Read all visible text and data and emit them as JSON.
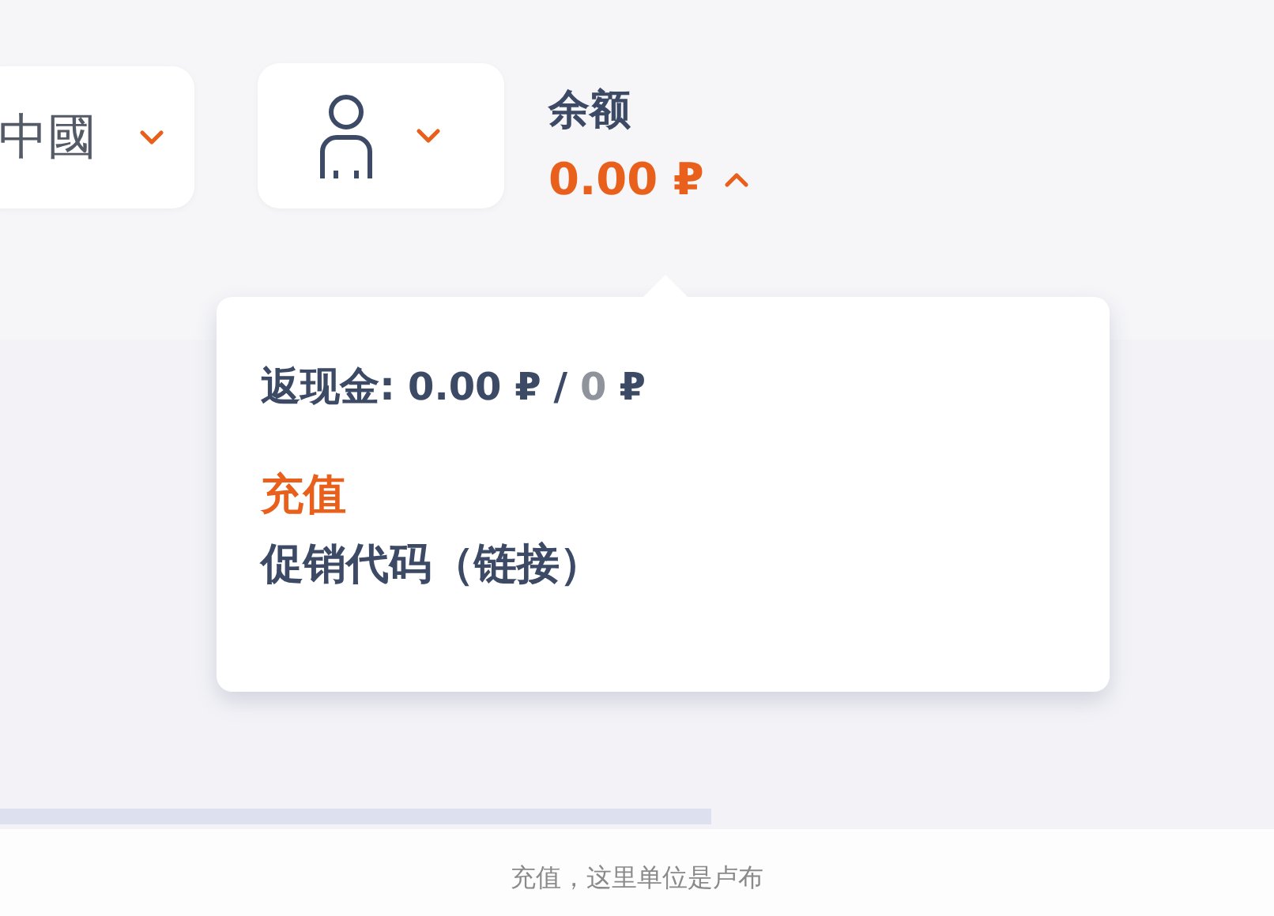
{
  "language_selector": {
    "label": "中國",
    "expanded": false
  },
  "account_menu": {
    "expanded": false
  },
  "balance": {
    "label": "余额",
    "amount": "0.00 ₽",
    "expanded": true
  },
  "balance_dropdown": {
    "cashback": {
      "label": "返现金:",
      "amount": "0.00 ₽",
      "separator": "/",
      "limit": "0",
      "currency": "₽"
    },
    "links": [
      {
        "label": "充值",
        "kind": "primary"
      },
      {
        "label": "促销代码（链接）",
        "kind": "default"
      }
    ]
  },
  "caption": "充值，这里单位是卢布"
}
